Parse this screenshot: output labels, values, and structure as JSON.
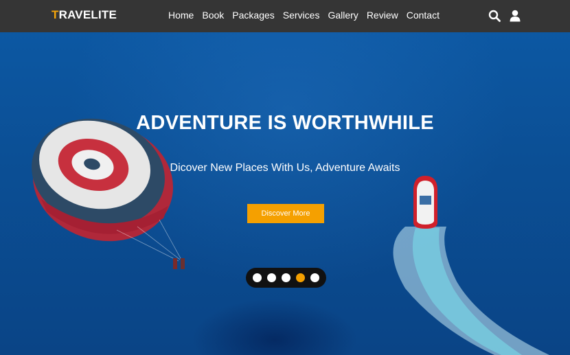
{
  "brand": {
    "first_letter": "T",
    "rest": "RAVELITE"
  },
  "nav": {
    "links": [
      "Home",
      "Book",
      "Packages",
      "Services",
      "Gallery",
      "Review",
      "Contact"
    ],
    "icons": [
      "search-icon",
      "user-icon"
    ]
  },
  "hero": {
    "title": "ADVENTURE IS WORTHWHILE",
    "subtitle": "Dicover New Places With Us, Adventure Awaits",
    "button_label": "Discover More"
  },
  "slider": {
    "dot_count": 5,
    "active_index": 3
  },
  "colors": {
    "navbar": "#353535",
    "accent": "#f5a000",
    "sea": "#0b4f95",
    "text": "#ffffff"
  }
}
